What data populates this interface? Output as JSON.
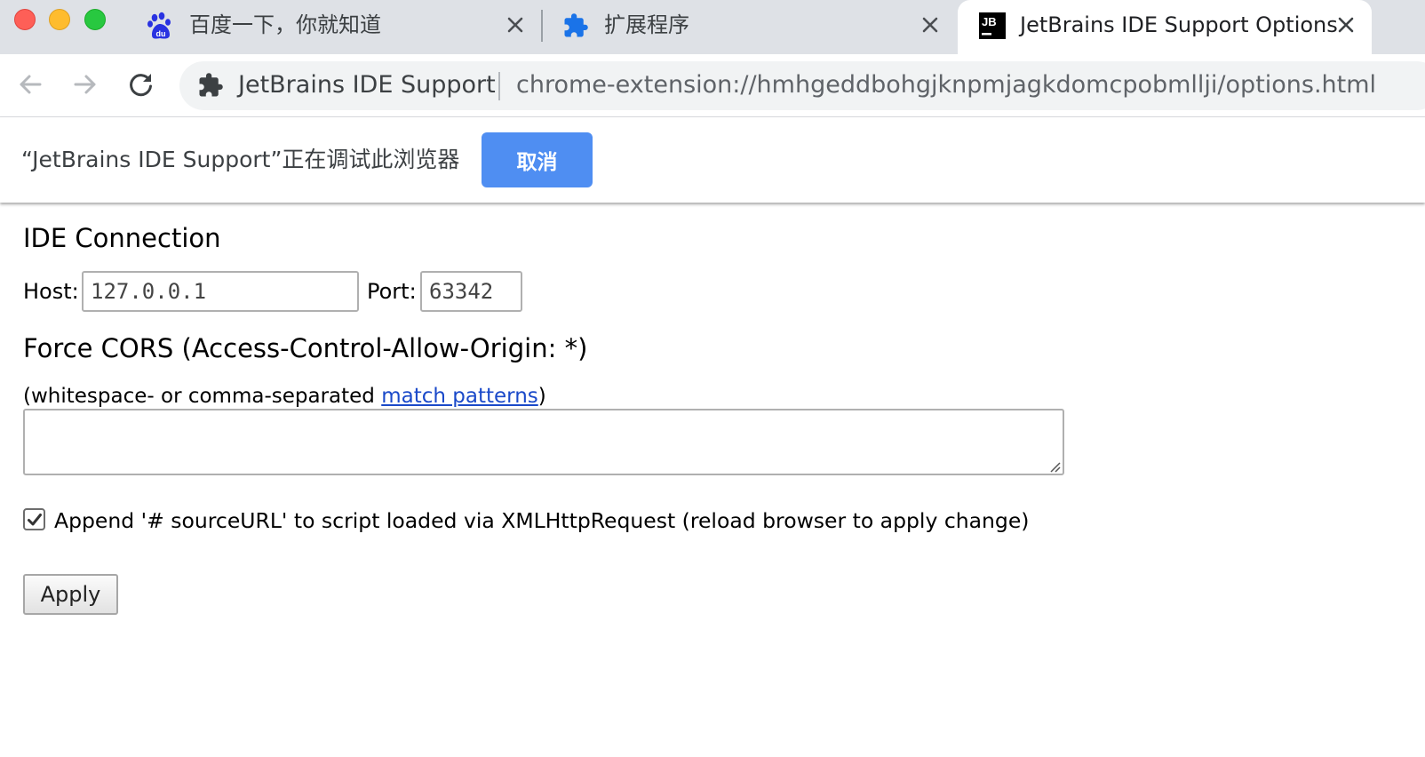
{
  "tabs": [
    {
      "title": "百度一下，你就知道",
      "icon": "baidu-paw-icon",
      "active": false
    },
    {
      "title": "扩展程序",
      "icon": "puzzle-piece-icon",
      "active": false
    },
    {
      "title": "JetBrains IDE Support Options",
      "icon": "jetbrains-logo-icon",
      "active": true
    }
  ],
  "tab_favicon_text": {
    "baidu": "du",
    "jetbrains": "JB"
  },
  "omnibox": {
    "site_name": "JetBrains IDE Support",
    "url": "chrome-extension://hmhgeddbohgjknpmjagkdomcpobmllji/options.html"
  },
  "infobar": {
    "message": "“JetBrains IDE Support”正在调试此浏览器",
    "cancel_label": "取消"
  },
  "page": {
    "ide_heading": "IDE Connection",
    "host_label": "Host:",
    "host_value": "127.0.0.1",
    "port_label": "Port:",
    "port_value": "63342",
    "cors_heading": "Force CORS (Access-Control-Allow-Origin: *)",
    "cors_hint_prefix": "(whitespace- or comma-separated ",
    "cors_hint_link": "match patterns",
    "cors_hint_suffix": ")",
    "cors_patterns_value": "",
    "source_url_checked": true,
    "source_url_label": "Append '# sourceURL' to script loaded via XMLHttpRequest (reload browser to apply change)",
    "apply_label": "Apply"
  },
  "colors": {
    "tabstrip_bg": "#dee1e6",
    "accent_button": "#4f8ef2",
    "link": "#1a49c9",
    "puzzle_blue": "#1a73e8",
    "baidu_blue": "#2932e1"
  }
}
